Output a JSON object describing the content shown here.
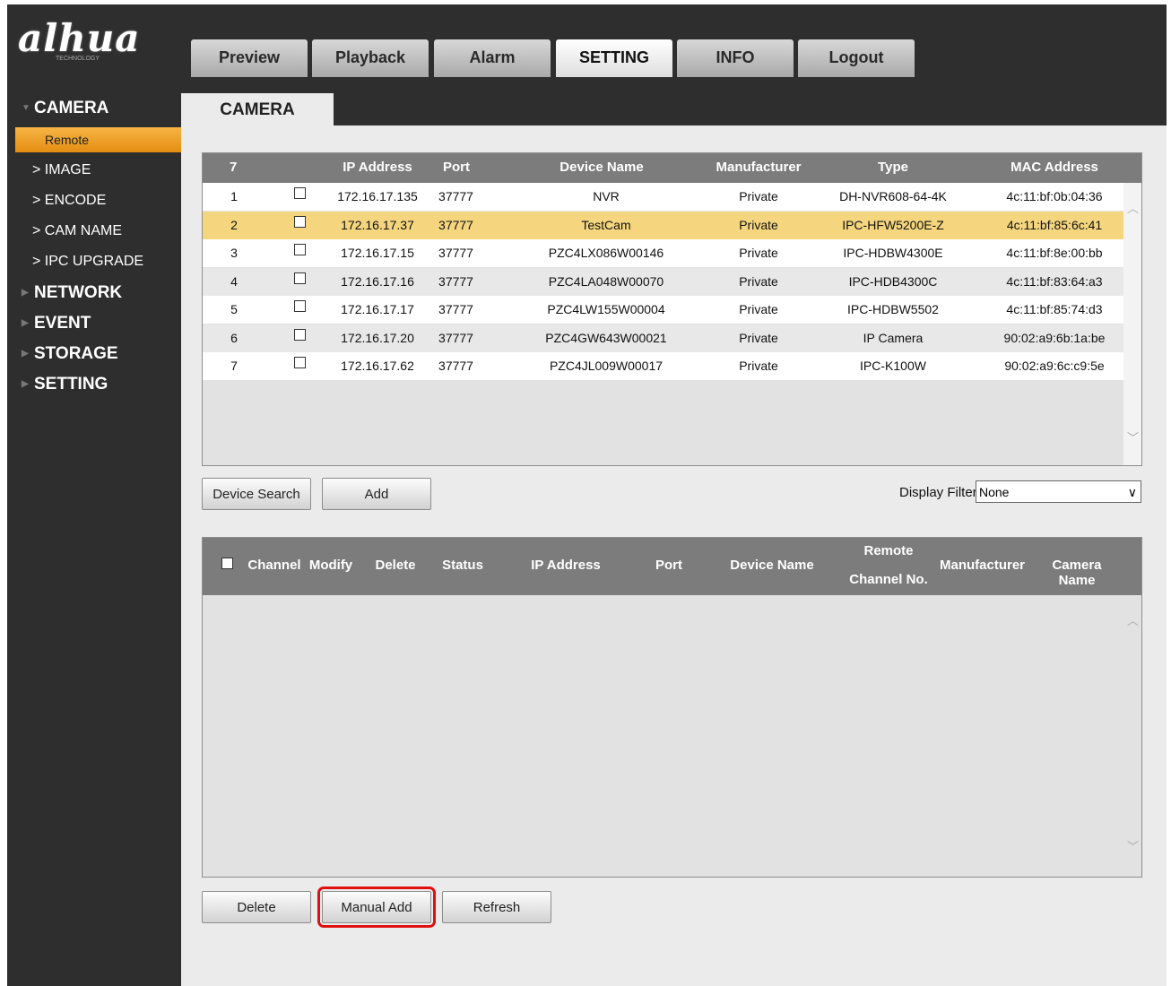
{
  "brand": {
    "name": "alhua",
    "sub": "TECHNOLOGY"
  },
  "nav_tabs": [
    {
      "label": "Preview"
    },
    {
      "label": "Playback"
    },
    {
      "label": "Alarm"
    },
    {
      "label": "SETTING",
      "active": true
    },
    {
      "label": "INFO"
    },
    {
      "label": "Logout"
    }
  ],
  "sidebar": {
    "sections": [
      {
        "label": "CAMERA",
        "expanded": true
      },
      {
        "label": "NETWORK"
      },
      {
        "label": "EVENT"
      },
      {
        "label": "STORAGE"
      },
      {
        "label": "SETTING"
      }
    ],
    "camera_items": [
      {
        "label": "Remote",
        "active": true
      },
      {
        "label": "IMAGE"
      },
      {
        "label": "ENCODE"
      },
      {
        "label": "CAM NAME"
      },
      {
        "label": "IPC UPGRADE"
      }
    ]
  },
  "page_tab": "CAMERA",
  "search_table": {
    "count": "7",
    "columns": [
      "IP Address",
      "Port",
      "Device Name",
      "Manufacturer",
      "Type",
      "MAC Address"
    ],
    "rows": [
      {
        "no": "1",
        "ip": "172.16.17.135",
        "port": "37777",
        "name": "NVR",
        "manufacturer": "Private",
        "type": "DH-NVR608-64-4K",
        "mac": "4c:11:bf:0b:04:36"
      },
      {
        "no": "2",
        "ip": "172.16.17.37",
        "port": "37777",
        "name": "TestCam",
        "manufacturer": "Private",
        "type": "IPC-HFW5200E-Z",
        "mac": "4c:11:bf:85:6c:41",
        "selected": true
      },
      {
        "no": "3",
        "ip": "172.16.17.15",
        "port": "37777",
        "name": "PZC4LX086W00146",
        "manufacturer": "Private",
        "type": "IPC-HDBW4300E",
        "mac": "4c:11:bf:8e:00:bb"
      },
      {
        "no": "4",
        "ip": "172.16.17.16",
        "port": "37777",
        "name": "PZC4LA048W00070",
        "manufacturer": "Private",
        "type": "IPC-HDB4300C",
        "mac": "4c:11:bf:83:64:a3"
      },
      {
        "no": "5",
        "ip": "172.16.17.17",
        "port": "37777",
        "name": "PZC4LW155W00004",
        "manufacturer": "Private",
        "type": "IPC-HDBW5502",
        "mac": "4c:11:bf:85:74:d3"
      },
      {
        "no": "6",
        "ip": "172.16.17.20",
        "port": "37777",
        "name": "PZC4GW643W00021",
        "manufacturer": "Private",
        "type": "IP Camera",
        "mac": "90:02:a9:6b:1a:be"
      },
      {
        "no": "7",
        "ip": "172.16.17.62",
        "port": "37777",
        "name": "PZC4JL009W00017",
        "manufacturer": "Private",
        "type": "IPC-K100W",
        "mac": "90:02:a9:6c:c9:5e"
      }
    ]
  },
  "buttons": {
    "device_search": "Device Search",
    "add": "Add",
    "delete": "Delete",
    "manual_add": "Manual Add",
    "refresh": "Refresh"
  },
  "display_filter": {
    "label": "Display Filter",
    "value": "None"
  },
  "added_table": {
    "columns": [
      "Channel",
      "Modify",
      "Delete",
      "Status",
      "IP Address",
      "Port",
      "Device Name",
      "Remote",
      "Channel No.",
      "Manufacturer",
      "Camera Name"
    ]
  },
  "colors": {
    "accent": "#f0a030",
    "selected_row": "#f5d67e",
    "highlight_outline": "#e01010",
    "background": "#2e2e2e"
  }
}
